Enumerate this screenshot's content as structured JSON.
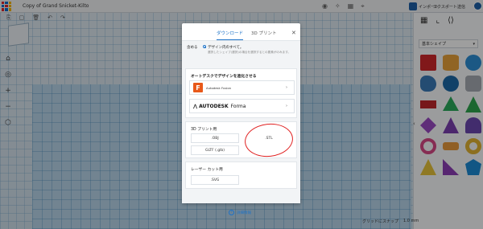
{
  "app": {
    "title": "Copy of Grand Snicket-Kilto"
  },
  "topbar": {
    "import_label": "インポート",
    "export_label": "エクスポート",
    "share_label": "送信"
  },
  "modal": {
    "tabs": [
      {
        "label": "ダウンロード"
      },
      {
        "label": "3D プリント"
      }
    ],
    "close_icon": "close-icon",
    "include_label": "含める",
    "radio_label": "デザイン内のすべて。",
    "hint": "選択したシェイプ(選択)の場合を選択するとの要素がのみます。",
    "autodesk_section": {
      "title": "オートデスクでデザインを進化させる",
      "fusion_label": "Autodesk Fusion",
      "forma_brand": "AUTODESK",
      "forma_product": "Forma"
    },
    "print_section": {
      "title": "3D プリント用",
      "buttons": [
        {
          "label": ".OBJ"
        },
        {
          "label": ".STL"
        },
        {
          "label": "GLTF (.glb)"
        }
      ]
    },
    "laser_section": {
      "title": "レーザー カット用",
      "buttons": [
        {
          "label": ".SVG"
        }
      ]
    },
    "info_link": "詳細情報"
  },
  "right_panel": {
    "dropdown_value": "基本シェイプ",
    "shapes": [
      "box",
      "cylinder-orange",
      "sphere",
      "scribble",
      "sphere-dark",
      "cylinder-grey",
      "text-red",
      "pyramid-green",
      "roof",
      "diamond",
      "cone",
      "paraboloid",
      "ring",
      "ribbon",
      "torus",
      "pyramid-yellow",
      "wedge-purple",
      "icosa",
      "half-sphere",
      "polygon",
      "capsule",
      "tube",
      "star",
      "heart"
    ]
  },
  "status": {
    "snap_label": "グリッドにスナップ",
    "snap_value": "1.0 mm"
  }
}
